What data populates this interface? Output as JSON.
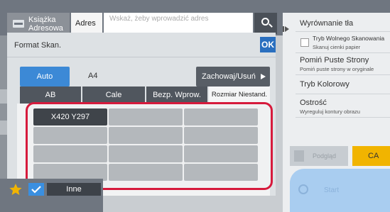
{
  "topbar": {
    "tab_address_book": "Książka Adresowa",
    "tab_address": "Adres",
    "search_placeholder": "Wskaż, żeby wprowadzić adres"
  },
  "dialog": {
    "title": "Format Skan.",
    "ok_label": "OK",
    "auto_label": "Auto",
    "size_value": "A4",
    "save_delete_label": "Zachowaj/Usuń",
    "tabs": [
      "AB",
      "Cale",
      "Bezp. Wprow.",
      "Rozmiar Niestand."
    ],
    "active_tab": "Rozmiar Niestand.",
    "grid_cells": [
      "X420 Y297",
      "",
      "",
      "",
      "",
      "",
      "",
      "",
      "",
      "",
      "",
      ""
    ]
  },
  "bottom_bar": {
    "other_label": "Inne"
  },
  "right_panel": {
    "items": [
      {
        "title": "Wyrównanie tła",
        "sub": ""
      },
      {
        "title": "Tryb Wolnego Skanowania",
        "sub": "Skanuj cienki papier"
      },
      {
        "title": "Pomiń Puste Strony",
        "sub": "Pomiń puste strony w oryginale"
      },
      {
        "title": "Tryb Kolorowy",
        "sub": ""
      },
      {
        "title": "Ostrość",
        "sub": "Wyreguluj kontury obrazu"
      }
    ],
    "preview_label": "Podgląd",
    "ca_label": "CA",
    "start_label": "Start"
  },
  "colors": {
    "accent_blue": "#3c89d6",
    "highlight_red": "#d61a3c",
    "ca_yellow": "#f1b400"
  }
}
